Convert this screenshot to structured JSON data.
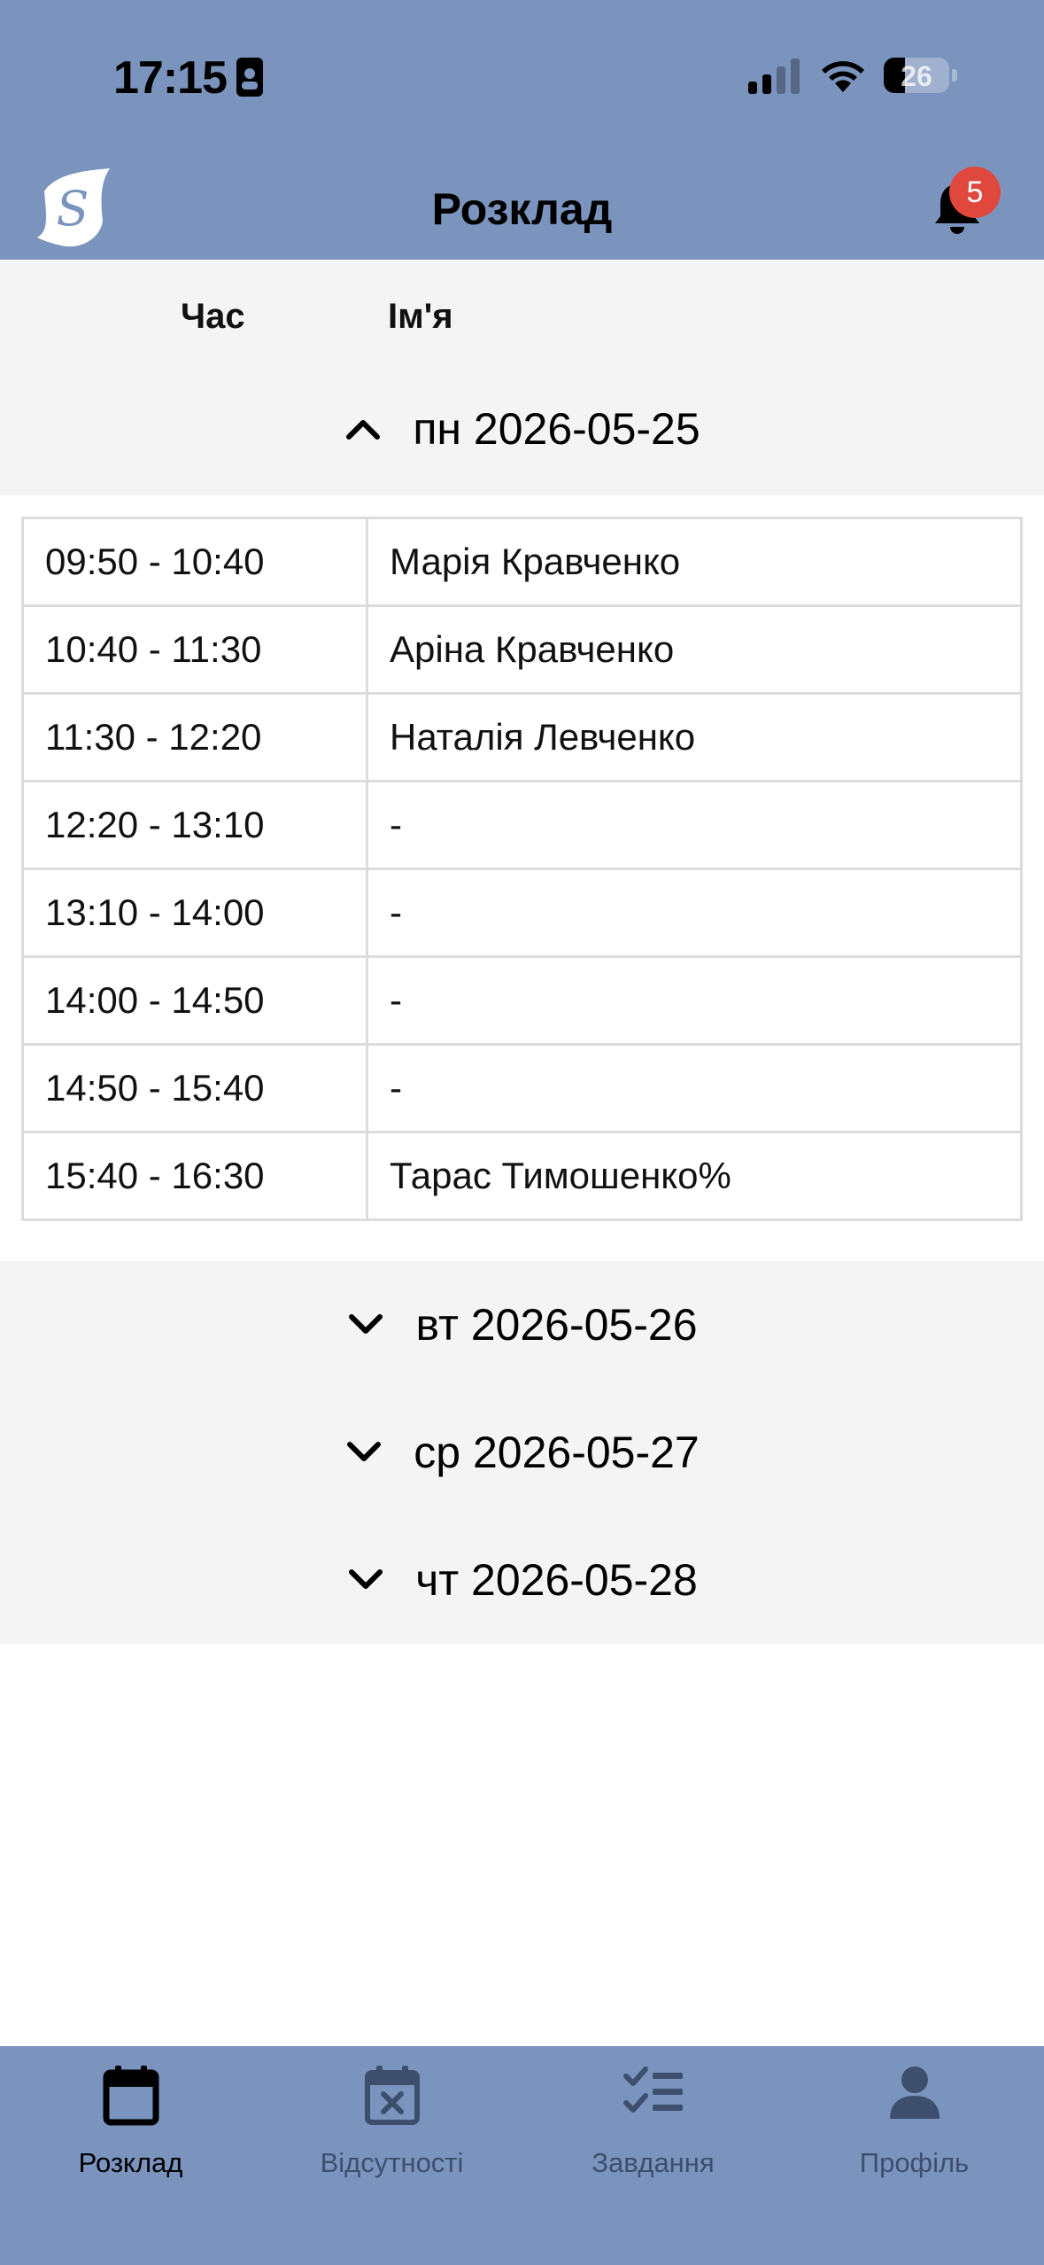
{
  "status_bar": {
    "time": "17:15",
    "battery": "26"
  },
  "app_bar": {
    "title": "Розклад",
    "notification_count": "5"
  },
  "table_header": {
    "time": "Час",
    "name": "Ім'я"
  },
  "days": [
    {
      "label": "пн 2026-05-25",
      "expanded": true,
      "slots": [
        {
          "time": "09:50 - 10:40",
          "name": "Марія Кравченко"
        },
        {
          "time": "10:40 - 11:30",
          "name": "Аріна Кравченко"
        },
        {
          "time": "11:30 - 12:20",
          "name": "Наталія Левченко"
        },
        {
          "time": "12:20 - 13:10",
          "name": "-"
        },
        {
          "time": "13:10 - 14:00",
          "name": "-"
        },
        {
          "time": "14:00 - 14:50",
          "name": "-"
        },
        {
          "time": "14:50 - 15:40",
          "name": "-"
        },
        {
          "time": "15:40 - 16:30",
          "name": "Тарас Тимошенко%"
        }
      ]
    },
    {
      "label": "вт 2026-05-26",
      "expanded": false
    },
    {
      "label": "ср 2026-05-27",
      "expanded": false
    },
    {
      "label": "чт 2026-05-28",
      "expanded": false
    }
  ],
  "bottom_nav": [
    {
      "label": "Розклад",
      "icon": "calendar-icon",
      "active": true
    },
    {
      "label": "Відсутності",
      "icon": "calendar-x-icon",
      "active": false
    },
    {
      "label": "Завдання",
      "icon": "tasks-checklist-icon",
      "active": false
    },
    {
      "label": "Профіль",
      "icon": "profile-icon",
      "active": false
    }
  ],
  "colors": {
    "header_bg": "#7a94bd",
    "badge": "#e0483e",
    "section_bg": "#f4f4f4"
  }
}
